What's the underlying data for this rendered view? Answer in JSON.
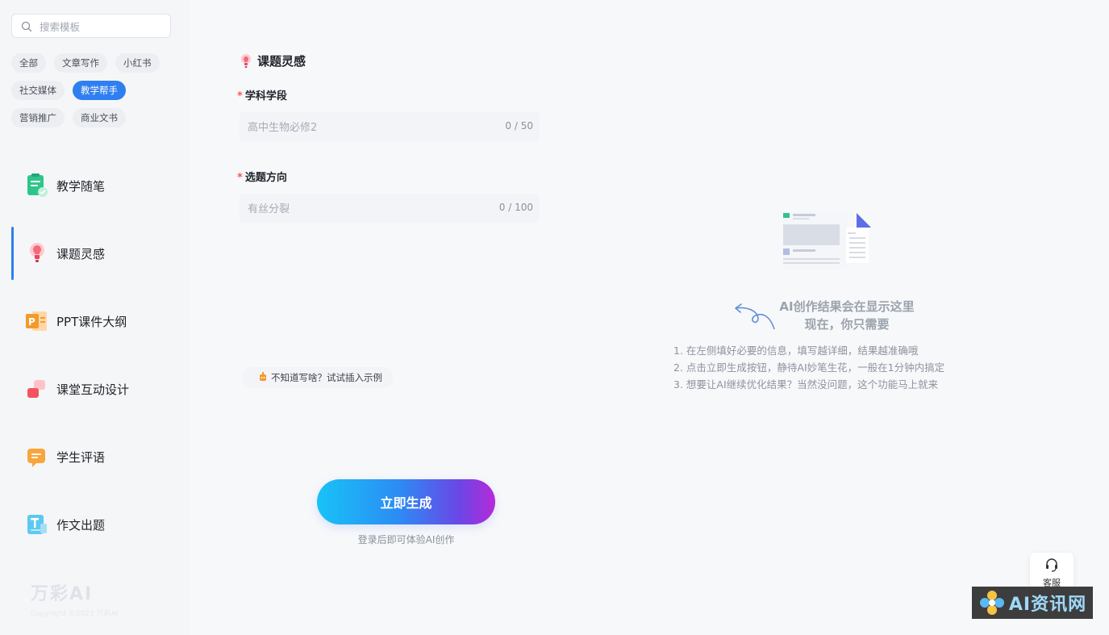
{
  "sidebar": {
    "search_placeholder": "搜索模板",
    "categories": [
      "全部",
      "文章写作",
      "小红书",
      "社交媒体",
      "教学帮手",
      "营销推广",
      "商业文书"
    ],
    "active_category": "教学帮手",
    "tools": [
      {
        "label": "教学随笔",
        "icon": "notebook-icon"
      },
      {
        "label": "课题灵感",
        "icon": "lightbulb-icon"
      },
      {
        "label": "PPT课件大纲",
        "icon": "ppt-icon"
      },
      {
        "label": "课堂互动设计",
        "icon": "interaction-icon"
      },
      {
        "label": "学生评语",
        "icon": "comment-icon"
      },
      {
        "label": "作文出题",
        "icon": "essay-icon"
      }
    ],
    "active_tool": "课题灵感",
    "brand_name": "万彩AI",
    "brand_copyright": "Copyright ©2023 万彩AI"
  },
  "form": {
    "title": "课题灵感",
    "fields": [
      {
        "label": "学科学段",
        "placeholder": "高中生物必修2",
        "count": "0 / 50",
        "required": true
      },
      {
        "label": "选题方向",
        "placeholder": "有丝分裂",
        "count": "0 / 100",
        "required": true
      }
    ],
    "hint": "不知道写啥？试试插入示例",
    "generate_label": "立即生成",
    "login_note": "登录后即可体验AI创作"
  },
  "result": {
    "title_line1": "AI创作结果会在显示这里",
    "title_line2": "现在，你只需要",
    "steps": [
      "1. 在左侧填好必要的信息，填写越详细，结果越准确哦",
      "2. 点击立即生成按钮，静待AI妙笔生花，一般在1分钟内搞定",
      "3. 想要让AI继续优化结果？当然没问题，这个功能马上就来"
    ]
  },
  "service_label": "客服",
  "watermark_text": "AI资讯网",
  "colors": {
    "accent": "#2f7ff0",
    "required": "#f25a5a"
  }
}
